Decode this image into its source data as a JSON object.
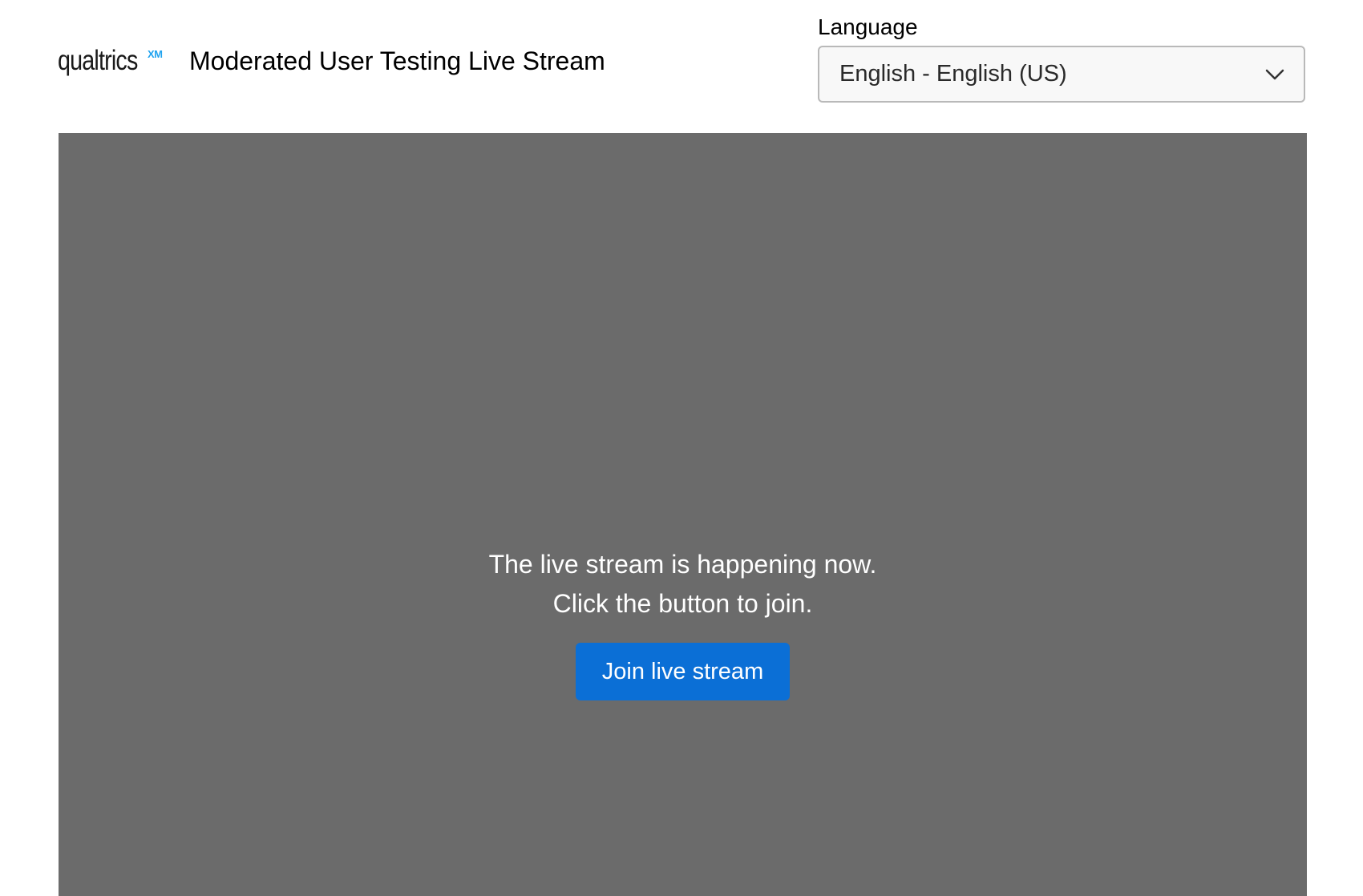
{
  "header": {
    "logo": {
      "wordmark": "qualtrics",
      "suffix": "XM",
      "suffix_color": "#21a3ef"
    },
    "title": "Moderated User Testing Live Stream"
  },
  "language": {
    "label": "Language",
    "selected": "English - English (US)",
    "icon": "chevron-down-icon"
  },
  "stage": {
    "background_color": "#6b6b6b",
    "message_line1": "The live stream is happening now.",
    "message_line2": "Click the button to join.",
    "join_button_label": "Join live stream",
    "join_button_color": "#0b6fd6"
  }
}
